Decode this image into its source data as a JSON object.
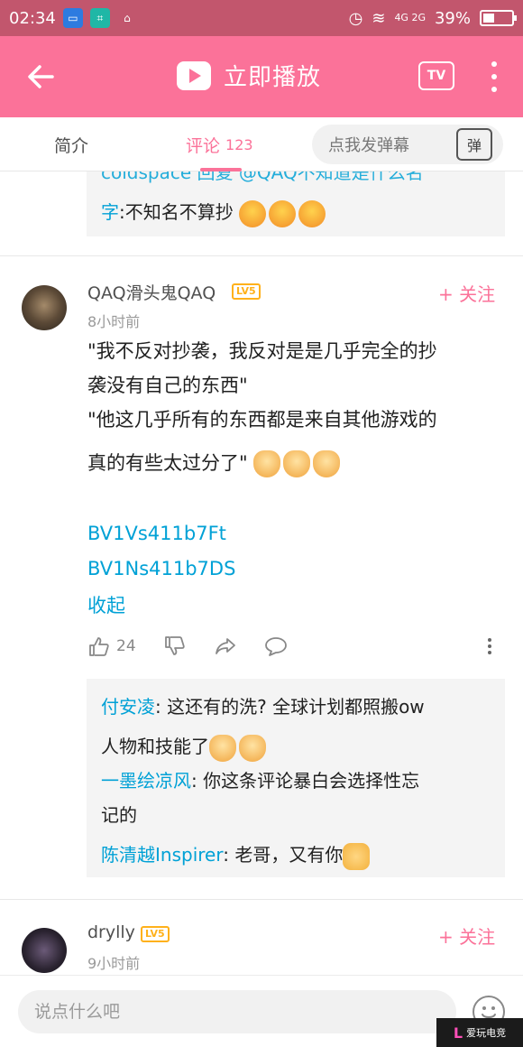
{
  "status_bar": {
    "time": "02:34",
    "network": "4G 2G",
    "battery": "39%",
    "battery_level": 0.39
  },
  "app_bar": {
    "title": "立即播放"
  },
  "tabs": {
    "intro": "简介",
    "comments": "评论",
    "comments_count": "123"
  },
  "danmaku": {
    "placeholder": "点我发弹幕",
    "button": "弹"
  },
  "top_reply": {
    "partial_line": "coldspace 回复 @QAQ不知道是什么名",
    "name": "字",
    "text": ":不知名不算抄"
  },
  "comment1": {
    "username": "QAQ滑头鬼QAQ",
    "level": "LV5",
    "time": "8小时前",
    "follow": "+ 关注",
    "lines": [
      "\"我不反对抄袭，我反对是是几乎完全的抄",
      "袭没有自己的东西\"",
      "\"他这几乎所有的东西都是来自其他游戏的",
      "真的有些太过分了\""
    ],
    "links": [
      "BV1Vs411b7Ft",
      "BV1Ns411b7DS"
    ],
    "collapse": "收起",
    "likes": "24",
    "replies": [
      {
        "name": "付安凌",
        "text": ": 这还有的洗? 全球计划都照搬ow",
        "text2": "人物和技能了"
      },
      {
        "name": "一墨绘凉风",
        "text": ": 你这条评论暴白会选择性忘",
        "text2": "记的"
      },
      {
        "name": "陈清越Inspirer",
        "text": ": 老哥，又有你"
      }
    ]
  },
  "comment2": {
    "username": "drylly",
    "level": "LV5",
    "time": "9小时前",
    "follow": "+ 关注"
  },
  "bottom": {
    "placeholder": "说点什么吧"
  },
  "watermark": {
    "text": "爱玩电竞"
  },
  "colors": {
    "brand_pink": "#fb7299",
    "link_blue": "#00a1d6",
    "level_orange": "#ffb11b"
  }
}
